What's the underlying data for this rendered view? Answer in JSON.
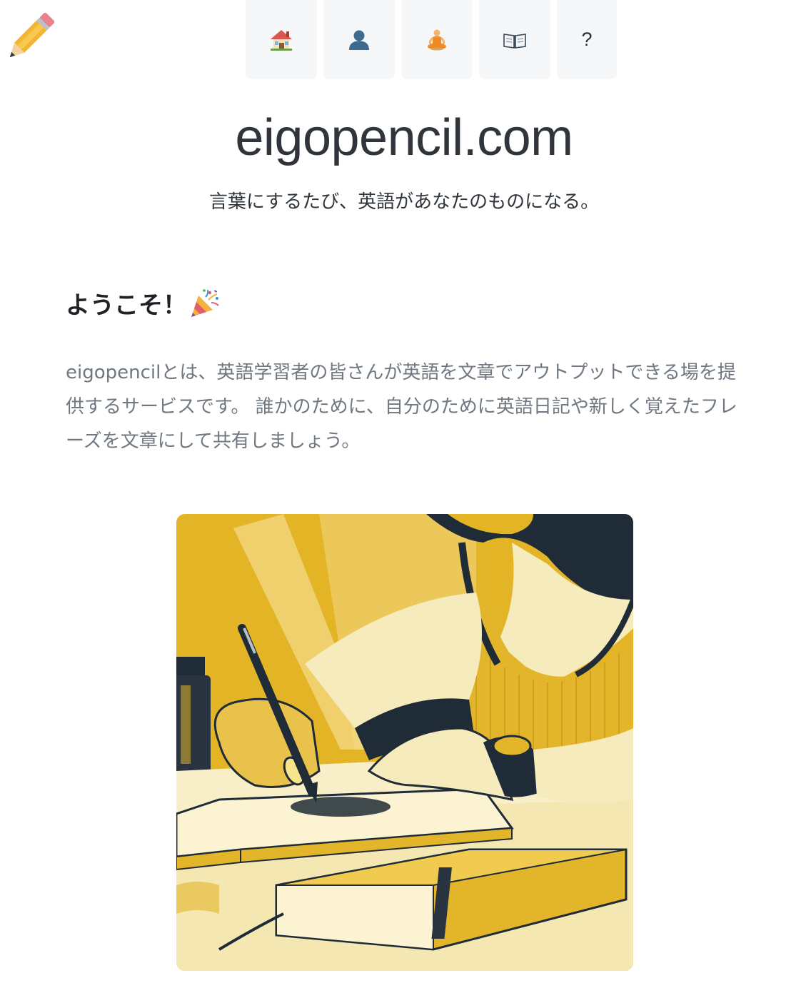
{
  "header": {
    "logo_icon": "pencil-icon",
    "nav": [
      {
        "icon": "house-icon"
      },
      {
        "icon": "user-silhouette-icon"
      },
      {
        "icon": "meditation-icon"
      },
      {
        "icon": "open-book-icon"
      },
      {
        "icon": "question-icon",
        "label": "?"
      }
    ]
  },
  "hero_text": {
    "site_title": "eigopencil.com",
    "tagline": "言葉にするたび、英語があなたのものになる。"
  },
  "welcome": {
    "heading": "ようこそ！",
    "heading_icon": "party-popper-icon",
    "intro": "eigopencilとは、英語学習者の皆さんが英語を文章でアウトプットできる場を提供するサービスです。 誰かのために、自分のために英語日記や新しく覚えたフレーズを文章にして共有しましょう。"
  },
  "colors": {
    "accent_yellow": "#e2b52a",
    "navy": "#1f2b36",
    "cream": "#f6ebbd",
    "text_dark": "#2f353b",
    "text_muted": "#6f7780",
    "nav_bg": "#f6f7f8"
  }
}
